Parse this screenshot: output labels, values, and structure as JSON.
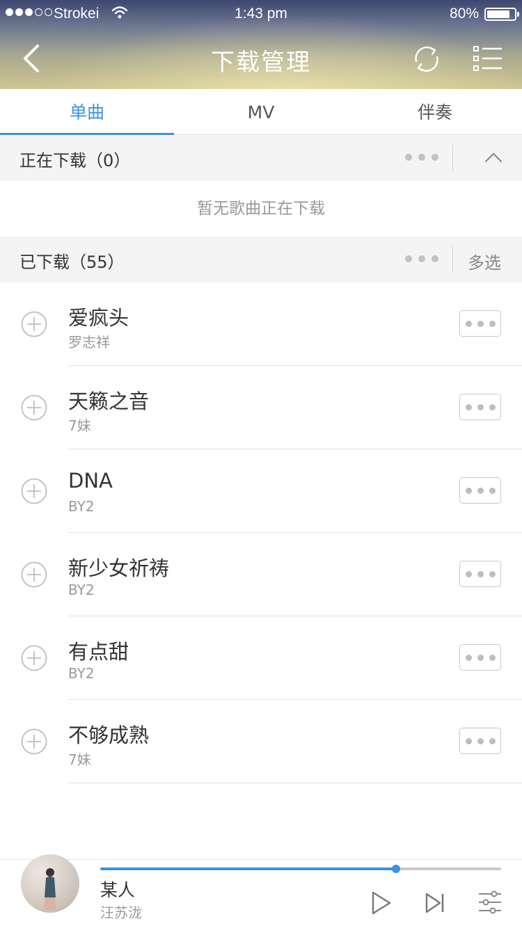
{
  "status_bar": {
    "carrier": "Strokei",
    "time": "1:43 pm",
    "battery_percent": "80%",
    "signal_bars_on": 3,
    "signal_bars_total": 5
  },
  "nav": {
    "title": "下载管理",
    "back_icon": "chevron-left-icon",
    "refresh_icon": "refresh-icon",
    "menu_icon": "list-menu-icon"
  },
  "tabs": [
    {
      "label": "单曲",
      "active": true
    },
    {
      "label": "MV",
      "active": false
    },
    {
      "label": "伴奏",
      "active": false
    }
  ],
  "downloading": {
    "title": "正在下载（0）",
    "empty_text": "暂无歌曲正在下载"
  },
  "downloaded": {
    "title": "已下载（55）",
    "multi_select_label": "多选"
  },
  "songs": [
    {
      "title": "爱疯头",
      "artist": "罗志祥"
    },
    {
      "title": "天籁之音",
      "artist": "7妹"
    },
    {
      "title": "DNA",
      "artist": "BY2"
    },
    {
      "title": "新少女祈祷",
      "artist": "BY2"
    },
    {
      "title": "有点甜",
      "artist": "BY2"
    },
    {
      "title": "不够成熟",
      "artist": "7妹"
    }
  ],
  "player": {
    "title": "某人",
    "artist": "汪苏泷",
    "progress": 0.738
  },
  "colors": {
    "accent": "#3a92e4",
    "section_bg": "#f4f4f4",
    "divider": "#e2e2e2"
  }
}
